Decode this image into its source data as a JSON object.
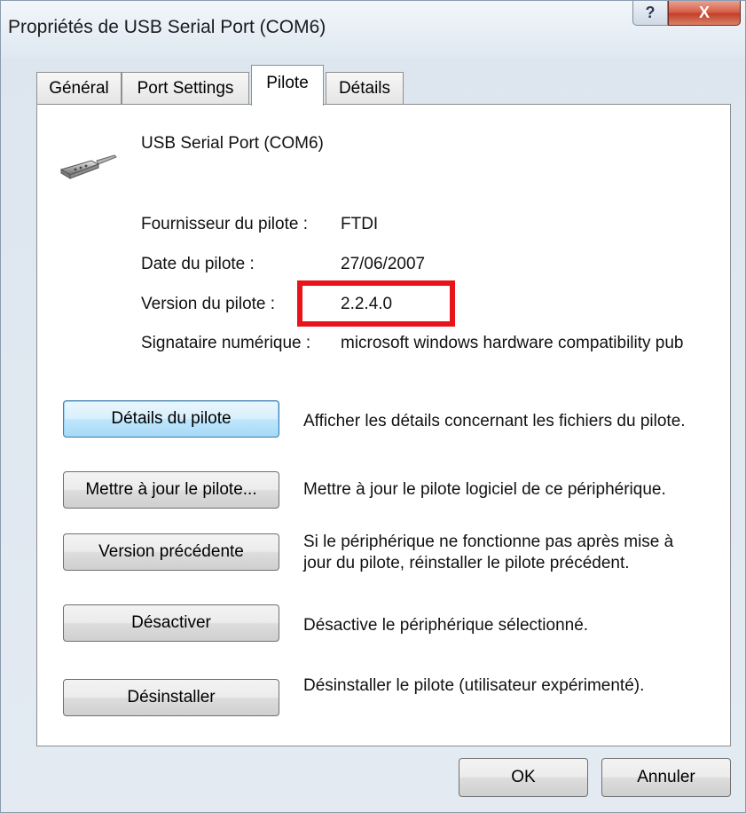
{
  "window": {
    "title": "Propriétés de USB Serial Port (COM6)",
    "help_glyph": "?",
    "close_glyph": "X"
  },
  "tabs": [
    {
      "label": "Général",
      "active": false
    },
    {
      "label": "Port Settings",
      "active": false
    },
    {
      "label": "Pilote",
      "active": true
    },
    {
      "label": "Détails",
      "active": false
    }
  ],
  "device": {
    "name": "USB Serial Port (COM6)",
    "icon": "usb-serial-port-icon"
  },
  "info": {
    "provider_label": "Fournisseur du pilote :",
    "provider_value": "FTDI",
    "date_label": "Date du pilote :",
    "date_value": "27/06/2007",
    "version_label": "Version du pilote :",
    "version_value": "2.2.4.0",
    "signer_label": "Signataire numérique :",
    "signer_value": "microsoft windows hardware compatibility pub"
  },
  "actions": [
    {
      "button": "Détails du pilote",
      "description": "Afficher les détails concernant les fichiers du pilote."
    },
    {
      "button": "Mettre à jour le pilote...",
      "description": "Mettre à jour le pilote logiciel de ce périphérique."
    },
    {
      "button": "Version précédente",
      "description": "Si le périphérique ne fonctionne pas après mise à jour du pilote, réinstaller le pilote précédent."
    },
    {
      "button": "Désactiver",
      "description": "Désactive le périphérique sélectionné."
    },
    {
      "button": "Désinstaller",
      "description": "Désinstaller le pilote (utilisateur expérimenté)."
    }
  ],
  "footer": {
    "ok_label": "OK",
    "cancel_label": "Annuler"
  },
  "colors": {
    "highlight": "#e8141a",
    "close_button": "#c4402a",
    "focused_button": "#3c7fb1"
  }
}
